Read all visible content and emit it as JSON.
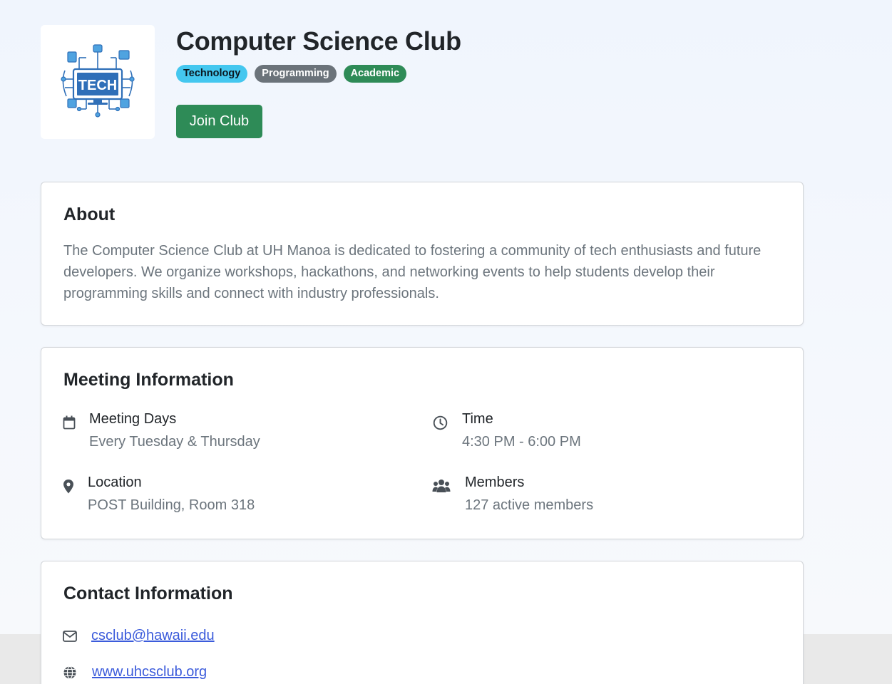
{
  "club": {
    "name": "Computer Science Club",
    "logo_text": "TECH",
    "tags": [
      "Technology",
      "Programming",
      "Academic"
    ],
    "join_label": "Join Club"
  },
  "about": {
    "title": "About",
    "text": "The Computer Science Club at UH Manoa is dedicated to fostering a community of tech enthusiasts and future developers. We organize workshops, hackathons, and networking events to help students develop their programming skills and connect with industry professionals."
  },
  "meeting": {
    "title": "Meeting Information",
    "days": {
      "label": "Meeting Days",
      "value": "Every Tuesday & Thursday",
      "icon": "calendar-icon"
    },
    "time": {
      "label": "Time",
      "value": "4:30 PM - 6:00 PM",
      "icon": "clock-icon"
    },
    "location": {
      "label": "Location",
      "value": "POST Building, Room 318",
      "icon": "map-pin-icon"
    },
    "members": {
      "label": "Members",
      "value": "127 active members",
      "icon": "users-icon"
    }
  },
  "contact": {
    "title": "Contact Information",
    "email": "csclub@hawaii.edu",
    "website": "www.uhcsclub.org"
  },
  "colors": {
    "primary_green": "#2e8b57",
    "tag_blue": "#44c7ef",
    "tag_gray": "#6b737a",
    "link_blue": "#3b5bdb"
  }
}
